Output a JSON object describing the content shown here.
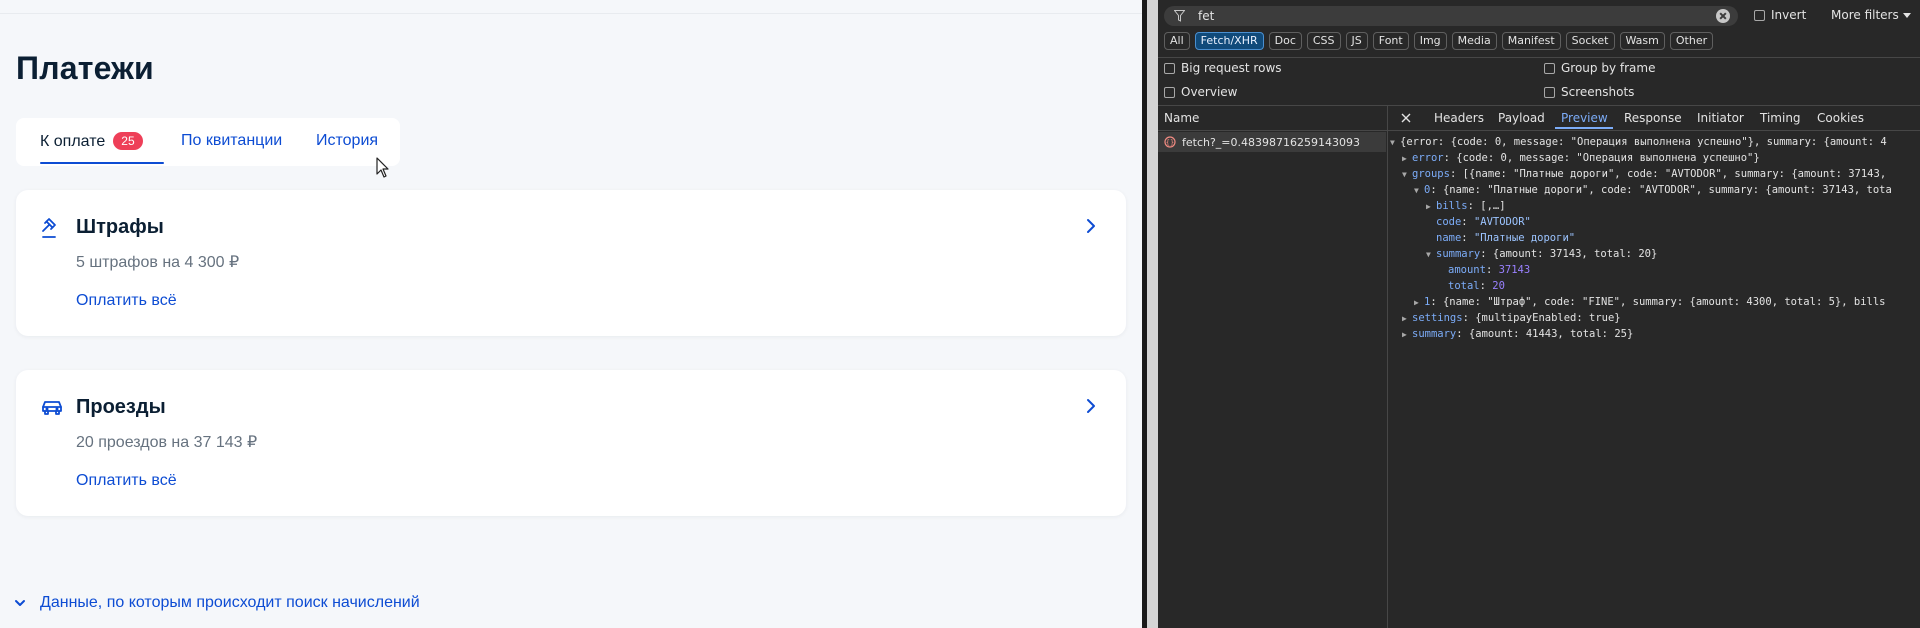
{
  "page": {
    "title": "Платежи",
    "tabs": [
      {
        "label": "К оплате",
        "badge": "25",
        "active": true
      },
      {
        "label": "По квитанции",
        "active": false
      },
      {
        "label": "История",
        "active": false
      }
    ],
    "cards": [
      {
        "title": "Штрафы",
        "subtitle": "5 штрафов на 4 300 ₽",
        "link": "Оплатить всё",
        "icon": "gavel-icon"
      },
      {
        "title": "Проезды",
        "subtitle": "20 проездов на 37 143 ₽",
        "link": "Оплатить всё",
        "icon": "car-icon"
      }
    ],
    "footer_link": "Данные, по которым происходит поиск начислений",
    "colors": {
      "accent": "#0d4cd3",
      "badge": "#ee3f58",
      "text": "#0b1f33",
      "muted": "#66727f"
    }
  },
  "devtools": {
    "filter_value": "fet",
    "invert_label": "Invert",
    "more_filters_label": "More filters",
    "type_filters": [
      "All",
      "Fetch/XHR",
      "Doc",
      "CSS",
      "JS",
      "Font",
      "Img",
      "Media",
      "Manifest",
      "Socket",
      "Wasm",
      "Other"
    ],
    "active_type": "Fetch/XHR",
    "options": {
      "big_request_rows": "Big request rows",
      "group_by_frame": "Group by frame",
      "overview": "Overview",
      "screenshots": "Screenshots"
    },
    "name_header": "Name",
    "detail_tabs": [
      "Headers",
      "Payload",
      "Preview",
      "Response",
      "Initiator",
      "Timing",
      "Cookies"
    ],
    "active_detail_tab": "Preview",
    "request_name": "fetch?_=0.48398716259143093",
    "preview_lines": [
      {
        "arrow": "▼",
        "indent": 0,
        "text": "{error: {code: 0, message: \"Операция выполнена успешно\"}, summary: {amount: 4"
      },
      {
        "arrow": "▶",
        "indent": 1,
        "key": "error",
        "text": "{code: 0, message: \"Операция выполнена успешно\"}"
      },
      {
        "arrow": "▼",
        "indent": 1,
        "key": "groups",
        "text": "[{name: \"Платные дороги\", code: \"AVTODOR\", summary: {amount: 37143,"
      },
      {
        "arrow": "▼",
        "indent": 2,
        "key": "0",
        "text": "{name: \"Платные дороги\", code: \"AVTODOR\", summary: {amount: 37143, tota"
      },
      {
        "arrow": "▶",
        "indent": 3,
        "key": "bills",
        "text": "[,…]"
      },
      {
        "arrow": "",
        "indent": 3,
        "key": "code",
        "value": "\"AVTODOR\"",
        "vtype": "str"
      },
      {
        "arrow": "",
        "indent": 3,
        "key": "name",
        "value": "\"Платные дороги\"",
        "vtype": "str"
      },
      {
        "arrow": "▼",
        "indent": 3,
        "key": "summary",
        "text": "{amount: 37143, total: 20}"
      },
      {
        "arrow": "",
        "indent": 4,
        "key": "amount",
        "value": "37143",
        "vtype": "num"
      },
      {
        "arrow": "",
        "indent": 4,
        "key": "total",
        "value": "20",
        "vtype": "num"
      },
      {
        "arrow": "▶",
        "indent": 2,
        "key": "1",
        "text": "{name: \"Штраф\", code: \"FINE\", summary: {amount: 4300, total: 5}, bills"
      },
      {
        "arrow": "▶",
        "indent": 1,
        "key": "settings",
        "text": "{multipayEnabled: true}"
      },
      {
        "arrow": "▶",
        "indent": 1,
        "key": "summary",
        "text": "{amount: 41443, total: 25}"
      }
    ]
  }
}
